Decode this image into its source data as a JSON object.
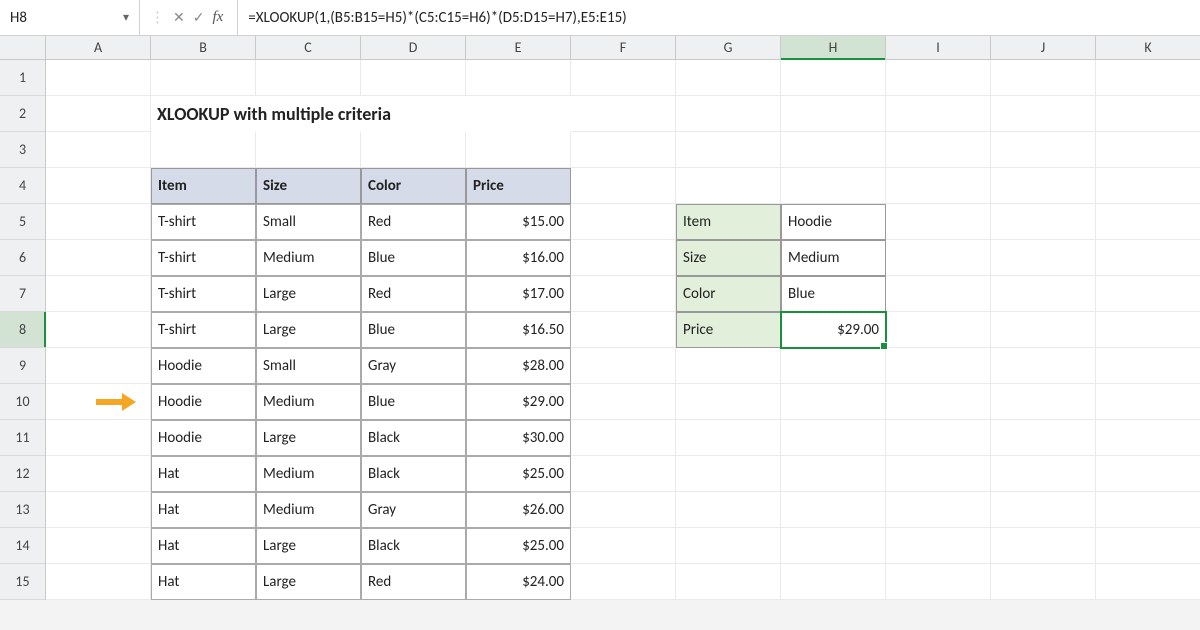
{
  "namebox": "H8",
  "formula": "=XLOOKUP(1,(B5:B15=H5)*(C5:C15=H6)*(D5:D15=H7),E5:E15)",
  "columns": [
    "A",
    "B",
    "C",
    "D",
    "E",
    "F",
    "G",
    "H",
    "I",
    "J",
    "K"
  ],
  "selected_col": "H",
  "selected_row": 8,
  "title": "XLOOKUP with multiple criteria",
  "headers": {
    "item": "Item",
    "size": "Size",
    "color": "Color",
    "price": "Price"
  },
  "table": [
    {
      "item": "T-shirt",
      "size": "Small",
      "color": "Red",
      "price": "$15.00"
    },
    {
      "item": "T-shirt",
      "size": "Medium",
      "color": "Blue",
      "price": "$16.00"
    },
    {
      "item": "T-shirt",
      "size": "Large",
      "color": "Red",
      "price": "$17.00"
    },
    {
      "item": "T-shirt",
      "size": "Large",
      "color": "Blue",
      "price": "$16.50"
    },
    {
      "item": "Hoodie",
      "size": "Small",
      "color": "Gray",
      "price": "$28.00"
    },
    {
      "item": "Hoodie",
      "size": "Medium",
      "color": "Blue",
      "price": "$29.00"
    },
    {
      "item": "Hoodie",
      "size": "Large",
      "color": "Black",
      "price": "$30.00"
    },
    {
      "item": "Hat",
      "size": "Medium",
      "color": "Black",
      "price": "$25.00"
    },
    {
      "item": "Hat",
      "size": "Medium",
      "color": "Gray",
      "price": "$26.00"
    },
    {
      "item": "Hat",
      "size": "Large",
      "color": "Black",
      "price": "$25.00"
    },
    {
      "item": "Hat",
      "size": "Large",
      "color": "Red",
      "price": "$24.00"
    }
  ],
  "lookup": {
    "labels": {
      "item": "Item",
      "size": "Size",
      "color": "Color",
      "price": "Price"
    },
    "values": {
      "item": "Hoodie",
      "size": "Medium",
      "color": "Blue",
      "price": "$29.00"
    }
  },
  "arrow_row": 10
}
